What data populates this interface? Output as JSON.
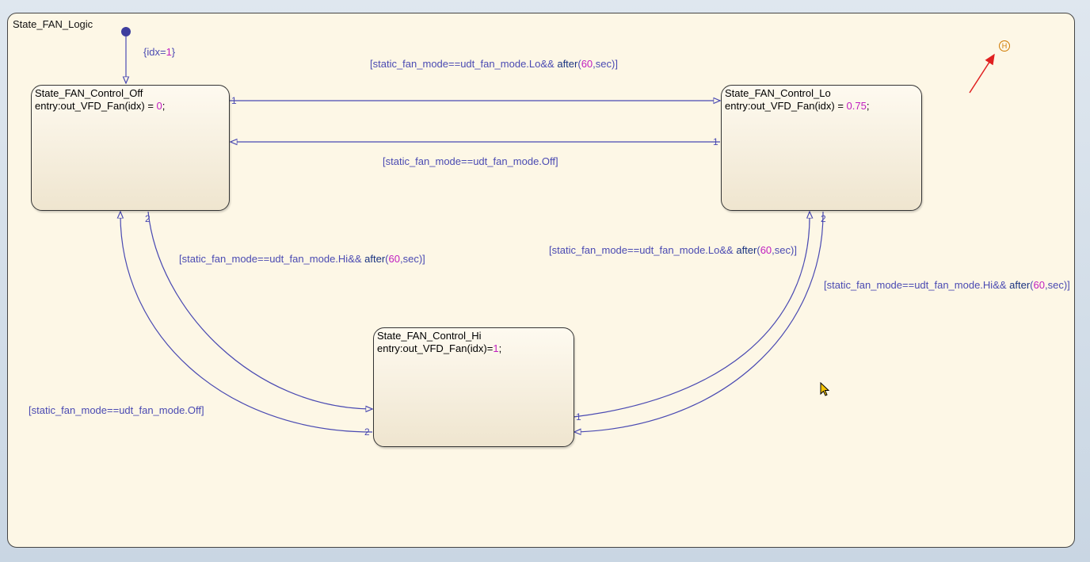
{
  "chart": {
    "title": "State_FAN_Logic"
  },
  "default_transition": {
    "label": "{idx=",
    "num": "1",
    "tail": "}"
  },
  "states": {
    "off": {
      "name": "State_FAN_Control_Off",
      "action_pre": "entry:out_VFD_Fan(idx) = ",
      "action_num": "0",
      "action_post": ";"
    },
    "lo": {
      "name": "State_FAN_Control_Lo",
      "action_pre": "entry:out_VFD_Fan(idx) = ",
      "action_num": "0.75",
      "action_post": ";"
    },
    "hi": {
      "name": "State_FAN_Control_Hi",
      "action_pre": "entry:out_VFD_Fan(idx)=",
      "action_num": "1",
      "action_post": ";"
    }
  },
  "transitions": {
    "off_to_lo": {
      "pre": "[static_fan_mode==udt_fan_mode.Lo&& ",
      "kw": "after",
      "open": "(",
      "num": "60",
      "post": ",sec)]"
    },
    "lo_to_off": {
      "text": "[static_fan_mode==udt_fan_mode.Off]"
    },
    "off_to_hi": {
      "pre": "[static_fan_mode==udt_fan_mode.Hi&& ",
      "kw": "after",
      "open": "(",
      "num": "60",
      "post": ",sec)]"
    },
    "hi_to_lo": {
      "pre": "[static_fan_mode==udt_fan_mode.Lo&& ",
      "kw": "after",
      "open": "(",
      "num": "60",
      "post": ",sec)]"
    },
    "lo_to_hi": {
      "pre": "[static_fan_mode==udt_fan_mode.Hi&& ",
      "kw": "after",
      "open": "(",
      "num": "60",
      "post": ",sec)]"
    },
    "hi_to_off": {
      "text": "[static_fan_mode==udt_fan_mode.Off]"
    }
  },
  "priorities": {
    "off_out_1": "1",
    "lo_out_1": "1",
    "off_out_2": "2",
    "lo_out_2": "2",
    "hi_out_1": "1",
    "hi_out_2": "2"
  },
  "history_junction": {
    "label": "H"
  },
  "colors": {
    "wire": "#4a4ab2",
    "number": "#c020c0",
    "keyword": "#1a3380",
    "history": "#d07a00",
    "annotation_arrow": "#e02020"
  }
}
